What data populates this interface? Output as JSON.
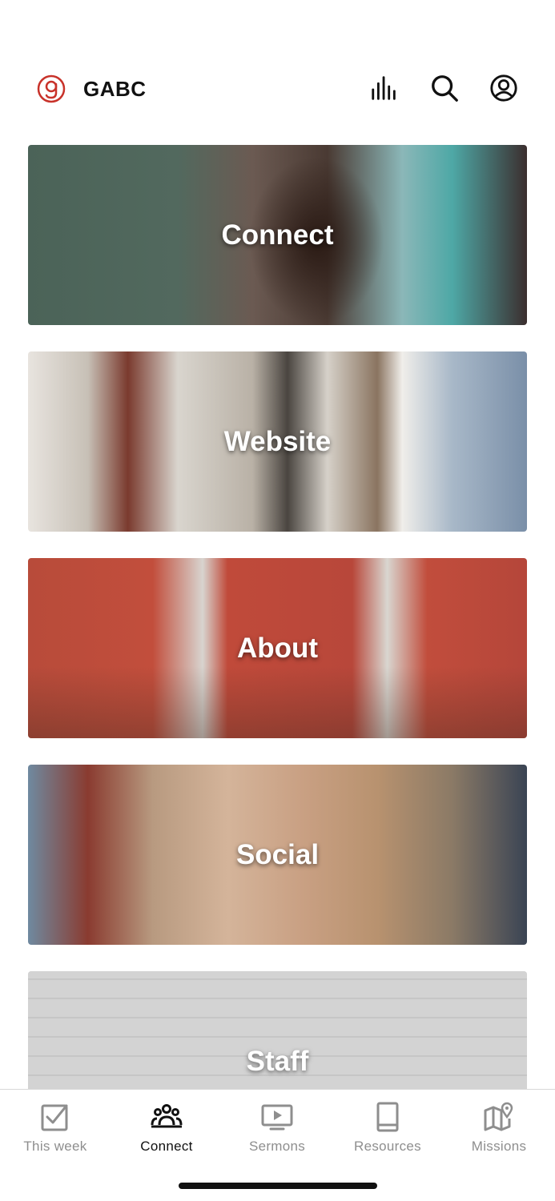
{
  "header": {
    "title": "GABC",
    "logo_icon": "gabc-logo-icon",
    "brand_color": "#c8322a",
    "actions": [
      {
        "icon": "audio-bars-icon"
      },
      {
        "icon": "search-icon"
      },
      {
        "icon": "profile-icon"
      }
    ]
  },
  "cards": [
    {
      "label": "Connect"
    },
    {
      "label": "Website"
    },
    {
      "label": "About"
    },
    {
      "label": "Social"
    },
    {
      "label": "Staff"
    }
  ],
  "tabbar": {
    "active_index": 1,
    "active_color": "#111111",
    "inactive_color": "#8e8e8e",
    "tabs": [
      {
        "label": "This week",
        "icon": "checkbox-icon"
      },
      {
        "label": "Connect",
        "icon": "people-icon"
      },
      {
        "label": "Sermons",
        "icon": "play-screen-icon"
      },
      {
        "label": "Resources",
        "icon": "book-icon"
      },
      {
        "label": "Missions",
        "icon": "map-pin-icon"
      }
    ]
  }
}
